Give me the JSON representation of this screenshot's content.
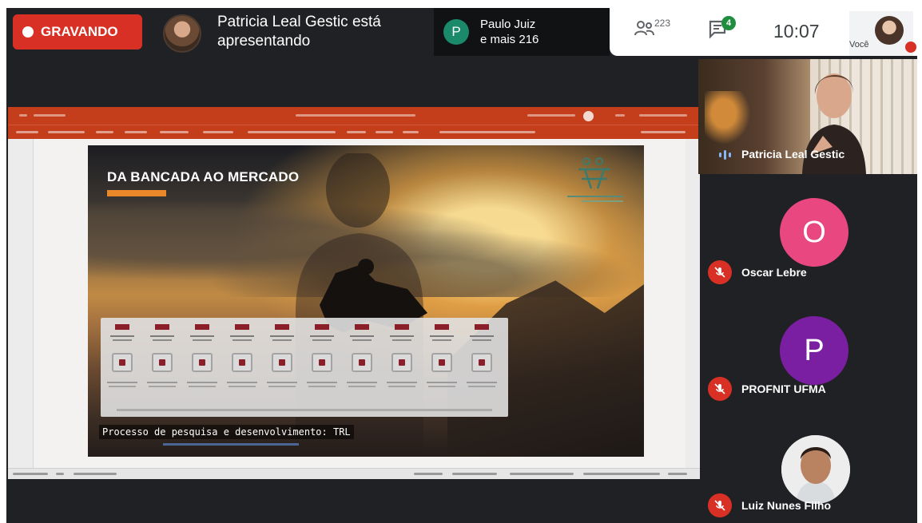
{
  "meeting": {
    "recording_label": "GRAVANDO",
    "presenter_line1": "Patricia Leal Gestic está",
    "presenter_line2": "apresentando",
    "viewers_initial": "P",
    "viewers_line1": "Paulo Juiz",
    "viewers_line2": "e mais 216",
    "participants_count": "223",
    "chat_badge": "4",
    "clock": "10:07",
    "self_label": "Você",
    "colors": {
      "recording": "#d93025",
      "dark_bg": "#202124",
      "ppt_accent": "#c43e1c",
      "viewer_chip": "#1a8a6a"
    }
  },
  "slide": {
    "title": "DA BANCADA AO MERCADO",
    "caption": "Processo de pesquisa e desenvolvimento: TRL",
    "trl_levels": 10
  },
  "participants": [
    {
      "name": "Patricia Leal Gestic",
      "status": "speaking",
      "icon": "voice-activity-icon"
    },
    {
      "name": "Oscar Lebre",
      "initial": "O",
      "color": "#e8487f",
      "status": "muted",
      "icon": "mic-off-icon"
    },
    {
      "name": "PROFNIT UFMA",
      "initial": "P",
      "color": "#7b1fa2",
      "status": "muted",
      "icon": "mic-off-icon"
    },
    {
      "name": "Luiz Nunes Filho",
      "status": "muted",
      "icon": "mic-off-icon"
    }
  ]
}
